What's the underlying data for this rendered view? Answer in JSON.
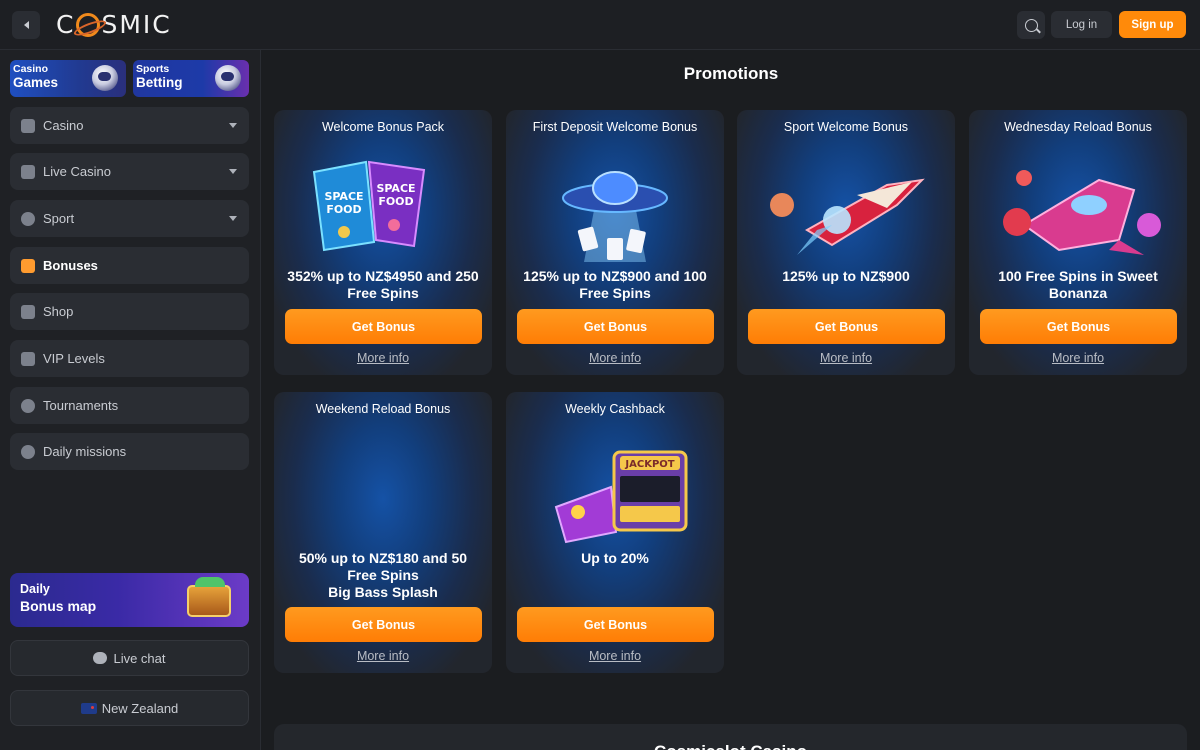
{
  "header": {
    "logo_text": "COSMIC",
    "login_label": "Log in",
    "signup_label": "Sign up"
  },
  "sidebar": {
    "tiles": [
      {
        "line1": "Casino",
        "line2": "Games"
      },
      {
        "line1": "Sports",
        "line2": "Betting"
      }
    ],
    "items": [
      {
        "label": "Casino",
        "icon": "joystick-icon",
        "has_dropdown": true
      },
      {
        "label": "Live Casino",
        "icon": "play-icon",
        "has_dropdown": true
      },
      {
        "label": "Sport",
        "icon": "ball-icon",
        "has_dropdown": true
      },
      {
        "label": "Bonuses",
        "icon": "gift-icon",
        "active": true
      },
      {
        "label": "Shop",
        "icon": "basket-icon"
      },
      {
        "label": "VIP Levels",
        "icon": "crown-icon"
      },
      {
        "label": "Tournaments",
        "icon": "trophy-icon"
      },
      {
        "label": "Daily missions",
        "icon": "medal-icon"
      }
    ],
    "daily_map": {
      "line1": "Daily",
      "line2": "Bonus map"
    },
    "live_chat_label": "Live chat",
    "country_label": "New Zealand"
  },
  "main": {
    "title": "Promotions",
    "cards": [
      {
        "title": "Welcome Bonus Pack",
        "offer": "352% up to NZ$4950 and 250 Free Spins",
        "button": "Get Bonus",
        "more": "More info"
      },
      {
        "title": "First Deposit Welcome Bonus",
        "offer": "125% up to NZ$900 and 100 Free Spins",
        "button": "Get Bonus",
        "more": "More info"
      },
      {
        "title": "Sport Welcome Bonus",
        "offer": "125% up to NZ$900",
        "button": "Get Bonus",
        "more": "More info"
      },
      {
        "title": "Wednesday Reload Bonus",
        "offer": "100 Free Spins in Sweet Bonanza",
        "button": "Get Bonus",
        "more": "More info"
      },
      {
        "title": "Weekend Reload Bonus",
        "offer_lines": [
          "50% up to NZ$180 and 50",
          "Free Spins",
          "Big Bass Splash"
        ],
        "button": "Get Bonus",
        "more": "More info"
      },
      {
        "title": "Weekly Cashback",
        "offer": "Up to 20%",
        "button": "Get Bonus",
        "more": "More info"
      }
    ],
    "bottom_title": "Cosmicslot Casino"
  },
  "colors": {
    "accent": "#ff8a0a",
    "bg": "#1b1d20"
  }
}
